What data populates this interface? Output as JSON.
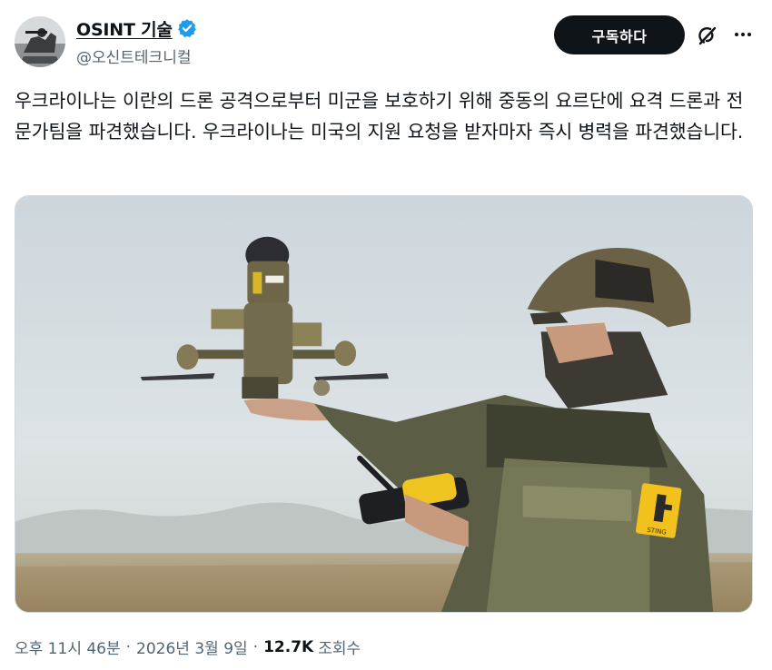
{
  "author": {
    "display_name": "OSINT 기술",
    "handle": "@오신트테크니컬",
    "verified": true
  },
  "actions": {
    "subscribe_label": "구독하다",
    "grok_icon": "grok-icon",
    "more_icon": "more-icon"
  },
  "post": {
    "text": "우크라이나는 이란의 드론 공격으로부터 미군을 보호하기 위해 중동의 요르단에 요격 드론과 전문가팀을 파견했습니다. 우크라이나는 미국의 지원 요청을 받자마자 즉시 병력을 파견했습니다.",
    "media_description": "soldier-holding-interceptor-drone",
    "patch_text": "STING"
  },
  "meta": {
    "time": "오후 11시 46분",
    "date": "2026년 3월 9일",
    "separator": "·",
    "views_count": "12.7K",
    "views_label": "조회수"
  },
  "colors": {
    "accent_blue": "#1d9bf0",
    "text_primary": "#0f1419",
    "text_secondary": "#536471",
    "button_bg": "#0f1419"
  }
}
